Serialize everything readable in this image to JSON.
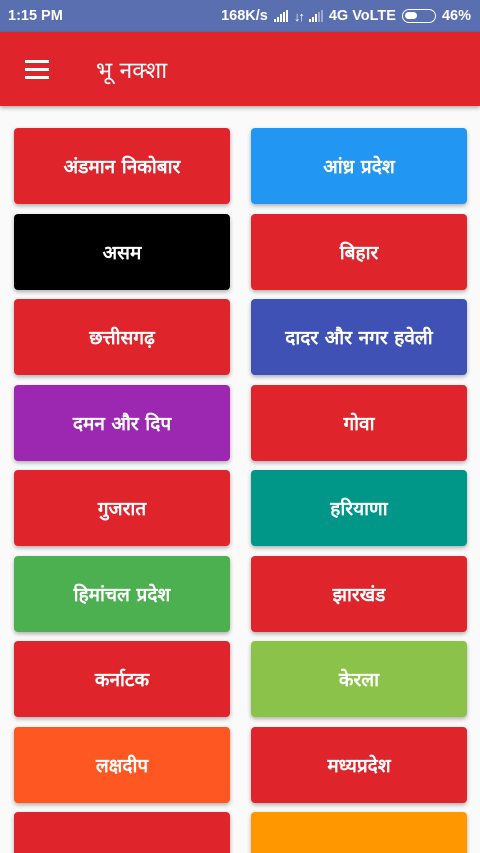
{
  "status_bar": {
    "time": "1:15 PM",
    "speed": "168K/s",
    "network": "4G VoLTE",
    "battery": "46%"
  },
  "toolbar": {
    "title": "भू नक्शा"
  },
  "colors": {
    "status_bar": "#5a6fb0",
    "toolbar": "#e0242b"
  },
  "states": [
    {
      "label": "अंडमान निकोबार",
      "color": "#e0242b"
    },
    {
      "label": "आंध्र प्रदेश",
      "color": "#2196f3"
    },
    {
      "label": "असम",
      "color": "#000000"
    },
    {
      "label": "बिहार",
      "color": "#e0242b"
    },
    {
      "label": "छत्तीसगढ़",
      "color": "#e0242b"
    },
    {
      "label": "दादर और नगर हवेली",
      "color": "#3f51b5"
    },
    {
      "label": "दमन और दिप",
      "color": "#9c27b0"
    },
    {
      "label": "गोवा",
      "color": "#e0242b"
    },
    {
      "label": "गुजरात",
      "color": "#e0242b"
    },
    {
      "label": "हरियाणा",
      "color": "#009688"
    },
    {
      "label": "हिमांचल प्रदेश",
      "color": "#4caf50"
    },
    {
      "label": "झारखंड",
      "color": "#e0242b"
    },
    {
      "label": "कर्नाटक",
      "color": "#e0242b"
    },
    {
      "label": "केरला",
      "color": "#8bc34a"
    },
    {
      "label": "लक्षदीप",
      "color": "#ff5722"
    },
    {
      "label": "मध्यप्रदेश",
      "color": "#e0242b"
    },
    {
      "label": "",
      "color": "#e0242b"
    },
    {
      "label": "",
      "color": "#ff9800"
    }
  ]
}
